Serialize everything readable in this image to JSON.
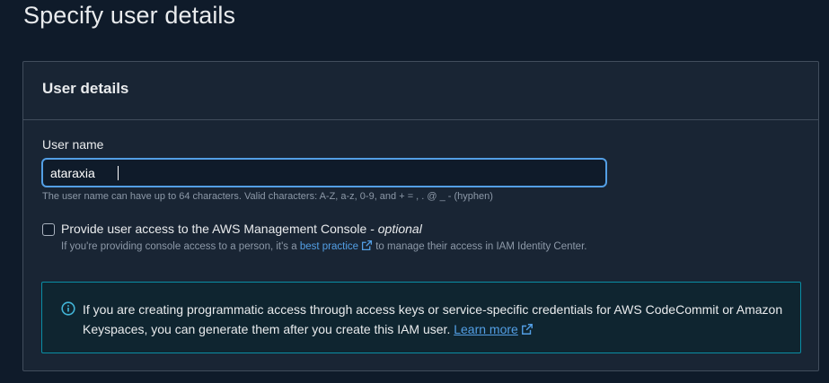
{
  "page": {
    "title": "Specify user details"
  },
  "panel": {
    "title": "User details",
    "user_name": {
      "label": "User name",
      "value": "ataraxia",
      "hint": "The user name can have up to 64 characters. Valid characters: A-Z, a-z, 0-9, and + = , . @ _ - (hyphen)"
    },
    "console_access": {
      "label": "Provide user access to the AWS Management Console - ",
      "optional": "optional",
      "desc_before": "If you're providing console access to a person, it's a ",
      "link": "best practice",
      "desc_after": " to manage their access in IAM Identity Center.",
      "checked": false
    },
    "info": {
      "text": "If you are creating programmatic access through access keys or service-specific credentials for AWS CodeCommit or Amazon Keyspaces, you can generate them after you create this IAM user. ",
      "link": "Learn more"
    }
  },
  "colors": {
    "background": "#0f1b2a",
    "panel": "#192534",
    "accent_link": "#539fe5",
    "info_border": "#0a8ea5"
  },
  "icons": [
    "external-link-icon",
    "info-icon"
  ]
}
